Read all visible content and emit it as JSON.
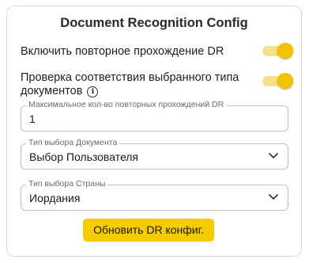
{
  "card": {
    "title": "Document Recognition Config"
  },
  "settings": [
    {
      "label_line1": "Включить повторное прохождение DR",
      "toggle_on": true
    },
    {
      "label_line1": "Проверка соответствия выбранного типа",
      "label_line2": "документов",
      "has_info_icon": true,
      "toggle_on": true
    }
  ],
  "fields": {
    "max_retries": {
      "label": "Максимальное кол-во повторных прохождений DR",
      "value": "1"
    },
    "document_type": {
      "label": "Тип выбора Документа",
      "value": "Выбор Пользователя"
    },
    "country_type": {
      "label": "Тип выбора Страны",
      "value": "Иордания"
    }
  },
  "actions": {
    "update_label": "Обновить DR конфиг."
  },
  "colors": {
    "accent": "#f5cc00",
    "toggle_track": "#f7e08a",
    "toggle_thumb": "#f4c300",
    "border": "#bdbdbd"
  },
  "icons": {
    "info": "info-icon",
    "select_chevron": "chevron-down-icon"
  }
}
